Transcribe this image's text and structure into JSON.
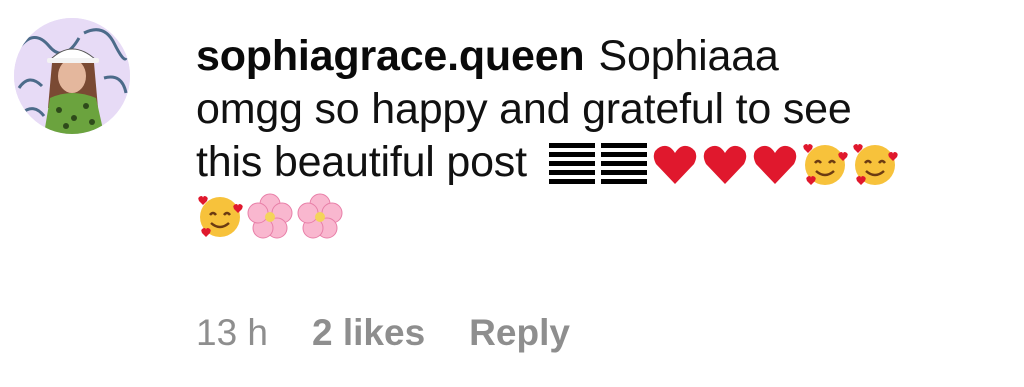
{
  "comment": {
    "username": "sophiagrace.queen",
    "text_line1": "Sophiaaa",
    "text_line2": "omgg so happy and grateful to see",
    "text_line3": "this beautiful post",
    "emojis": [
      "flag-stripes",
      "red-heart",
      "red-heart",
      "red-heart",
      "smiling-face-with-hearts",
      "smiling-face-with-hearts",
      "smiling-face-with-hearts",
      "cherry-blossom",
      "cherry-blossom"
    ],
    "avatar_icon": "profile-avatar"
  },
  "meta": {
    "time": "13 h",
    "likes": "2 likes",
    "reply_label": "Reply"
  },
  "colors": {
    "text": "#111111",
    "meta": "#8e8e8e",
    "heart": "#e0182d"
  }
}
